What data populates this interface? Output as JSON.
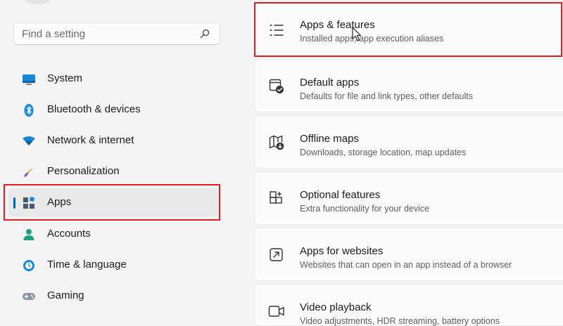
{
  "search": {
    "placeholder": "Find a setting",
    "icon": "search-icon"
  },
  "sidebar": {
    "items": [
      {
        "label": "System",
        "icon": "monitor-icon"
      },
      {
        "label": "Bluetooth & devices",
        "icon": "bluetooth-icon"
      },
      {
        "label": "Network & internet",
        "icon": "wifi-icon"
      },
      {
        "label": "Personalization",
        "icon": "brush-icon"
      },
      {
        "label": "Apps",
        "icon": "apps-icon",
        "selected": true
      },
      {
        "label": "Accounts",
        "icon": "person-icon"
      },
      {
        "label": "Time & language",
        "icon": "clock-globe-icon"
      },
      {
        "label": "Gaming",
        "icon": "gamepad-icon"
      }
    ]
  },
  "main": {
    "cards": [
      {
        "title": "Apps & features",
        "desc": "Installed apps, app execution aliases",
        "icon": "list-icon"
      },
      {
        "title": "Default apps",
        "desc": "Defaults for file and link types, other defaults",
        "icon": "default-apps-icon"
      },
      {
        "title": "Offline maps",
        "desc": "Downloads, storage location, map updates",
        "icon": "map-download-icon"
      },
      {
        "title": "Optional features",
        "desc": "Extra functionality for your device",
        "icon": "add-grid-icon"
      },
      {
        "title": "Apps for websites",
        "desc": "Websites that can open in an app instead of a browser",
        "icon": "open-link-icon"
      },
      {
        "title": "Video playback",
        "desc": "Video adjustments, HDR streaming, battery options",
        "icon": "video-camera-icon"
      }
    ]
  },
  "colors": {
    "accent": "#0067c0",
    "highlight": "#e02020"
  }
}
